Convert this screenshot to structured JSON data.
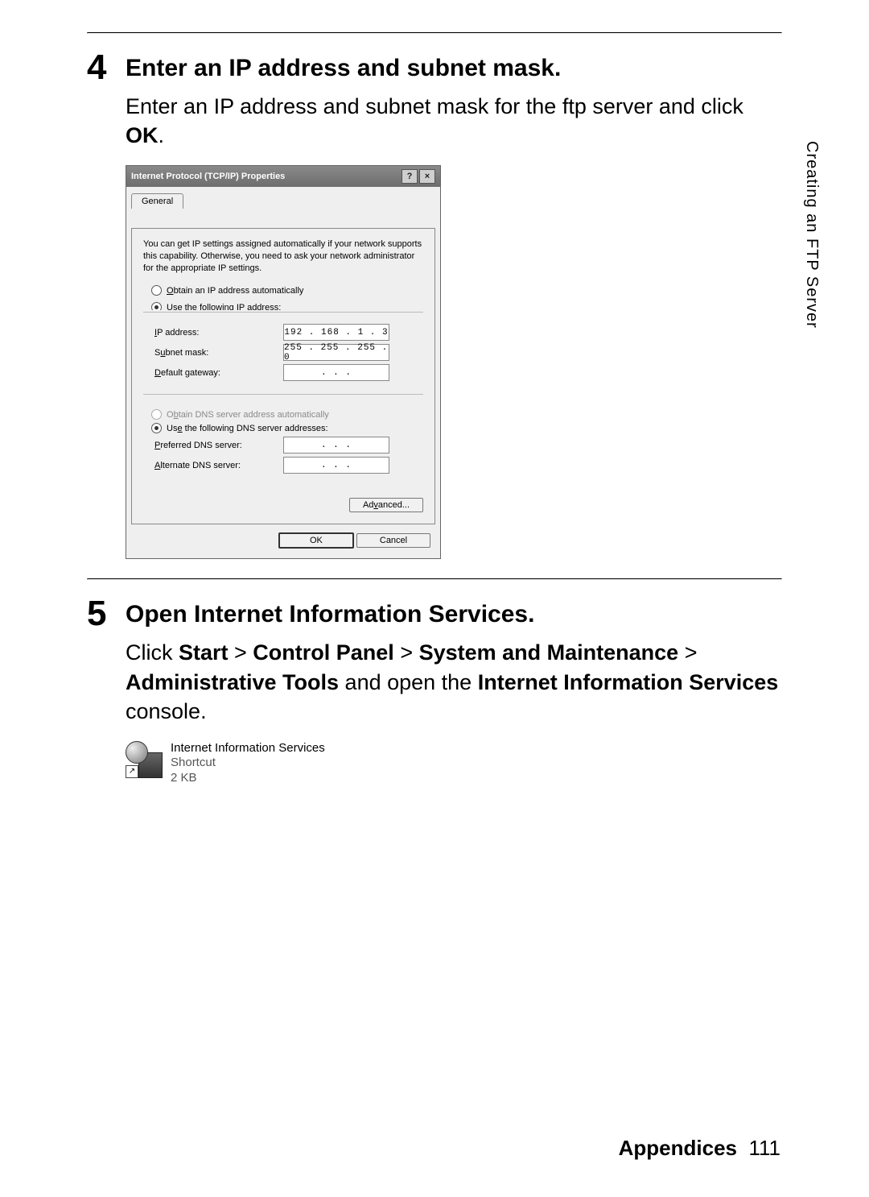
{
  "side_label": "Creating an FTP Server",
  "footer": {
    "section": "Appendices",
    "page": "111"
  },
  "step4": {
    "num": "4",
    "title": "Enter an IP address and subnet mask.",
    "body_plain": "Enter an IP address and subnet mask for the ftp server and click ",
    "body_bold": "OK",
    "body_after": "."
  },
  "dialog": {
    "title": "Internet Protocol (TCP/IP) Properties",
    "help_btn": "?",
    "close_btn": "×",
    "tab": "General",
    "description": "You can get IP settings assigned automatically if your network supports this capability. Otherwise, you need to ask your network administrator for the appropriate IP settings.",
    "radio_obtain_ip": "Obtain an IP address automatically",
    "radio_use_ip": "Use the following IP address:",
    "fields": {
      "ip_label": "IP address:",
      "ip_value": "192 . 168 .  1  .  3",
      "subnet_label": "Subnet mask:",
      "subnet_value": "255 . 255 . 255 .  0",
      "gateway_label": "Default gateway:",
      "gateway_value": ".       .       ."
    },
    "radio_obtain_dns": "Obtain DNS server address automatically",
    "radio_use_dns": "Use the following DNS server addresses:",
    "dns_fields": {
      "pref_label": "Preferred DNS server:",
      "pref_value": ".       .       .",
      "alt_label": "Alternate DNS server:",
      "alt_value": ".       .       ."
    },
    "advanced_btn": "Advanced...",
    "ok_btn": "OK",
    "cancel_btn": "Cancel"
  },
  "step5": {
    "num": "5",
    "title": "Open Internet Information Services.",
    "line_prefix": "Click ",
    "b1": "Start",
    "gt": " > ",
    "b2": "Control Panel",
    "b3": "System and Maintenance",
    "b4": "Administrative Tools",
    "mid": " and open the ",
    "b5": "Internet Information Services",
    "tail": " console."
  },
  "shortcut": {
    "name": "Internet Information Services",
    "type": "Shortcut",
    "size": "2 KB"
  }
}
